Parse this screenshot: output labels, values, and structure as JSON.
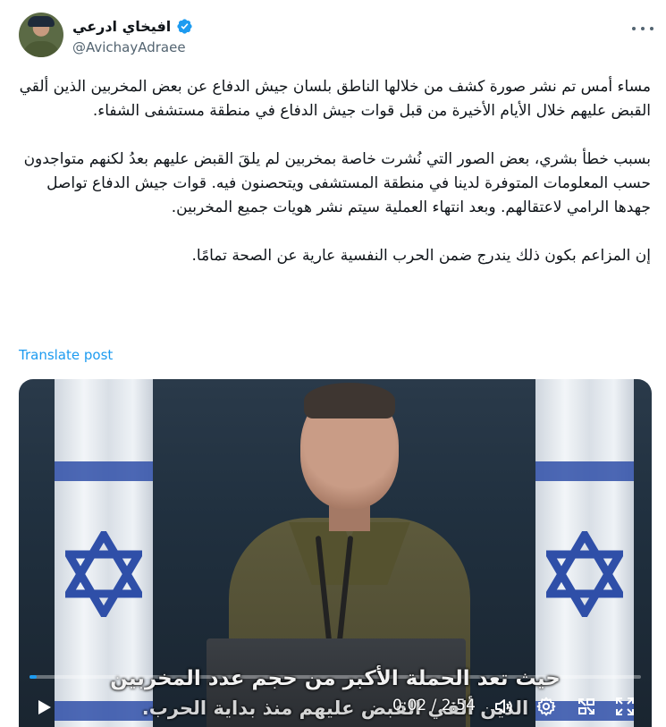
{
  "author": {
    "display_name": "افيخاي ادرعي",
    "handle": "@AvichayAdraee",
    "verified": true
  },
  "tweet": {
    "paragraphs": [
      "مساء أمس تم نشر صورة كشف من خلالها الناطق بلسان جيش الدفاع عن بعض المخربين الذين ألقي القبض عليهم خلال الأيام الأخيرة من قبل قوات جيش الدفاع في منطقة مستشفى الشفاء.",
      "بسبب خطأ بشري، بعض الصور التي نُشرت خاصة بمخربين لم يلقَ القبض عليهم بعدُ لكنهم متواجدون حسب المعلومات المتوفرة لدينا في منطقة المستشفى ويتحصنون فيه. قوات جيش الدفاع تواصل جهدها الرامي لاعتقالهم. وبعد انتهاء العملية سيتم نشر هويات جميع المخربين.",
      "إن المزاعم بكون ذلك يندرج ضمن الحرب النفسية عارية عن الصحة تمامًا."
    ]
  },
  "translate_label": "Translate post",
  "video": {
    "subtitle_line1": "حيث تعد الحملة الأكبر من حجم عدد المخربين",
    "subtitle_line2": "الذين ألقي القبض عليهم منذ بداية الحرب.",
    "time_display": "0:02 / 2:54",
    "progress_fraction": 0.012
  },
  "colors": {
    "accent": "#1d9bf0",
    "text": "#0f1419",
    "secondary": "#536471"
  },
  "icons": [
    "verified-badge-icon",
    "more-options-icon",
    "play-icon",
    "volume-icon",
    "settings-icon",
    "picture-in-picture-icon",
    "fullscreen-icon"
  ]
}
